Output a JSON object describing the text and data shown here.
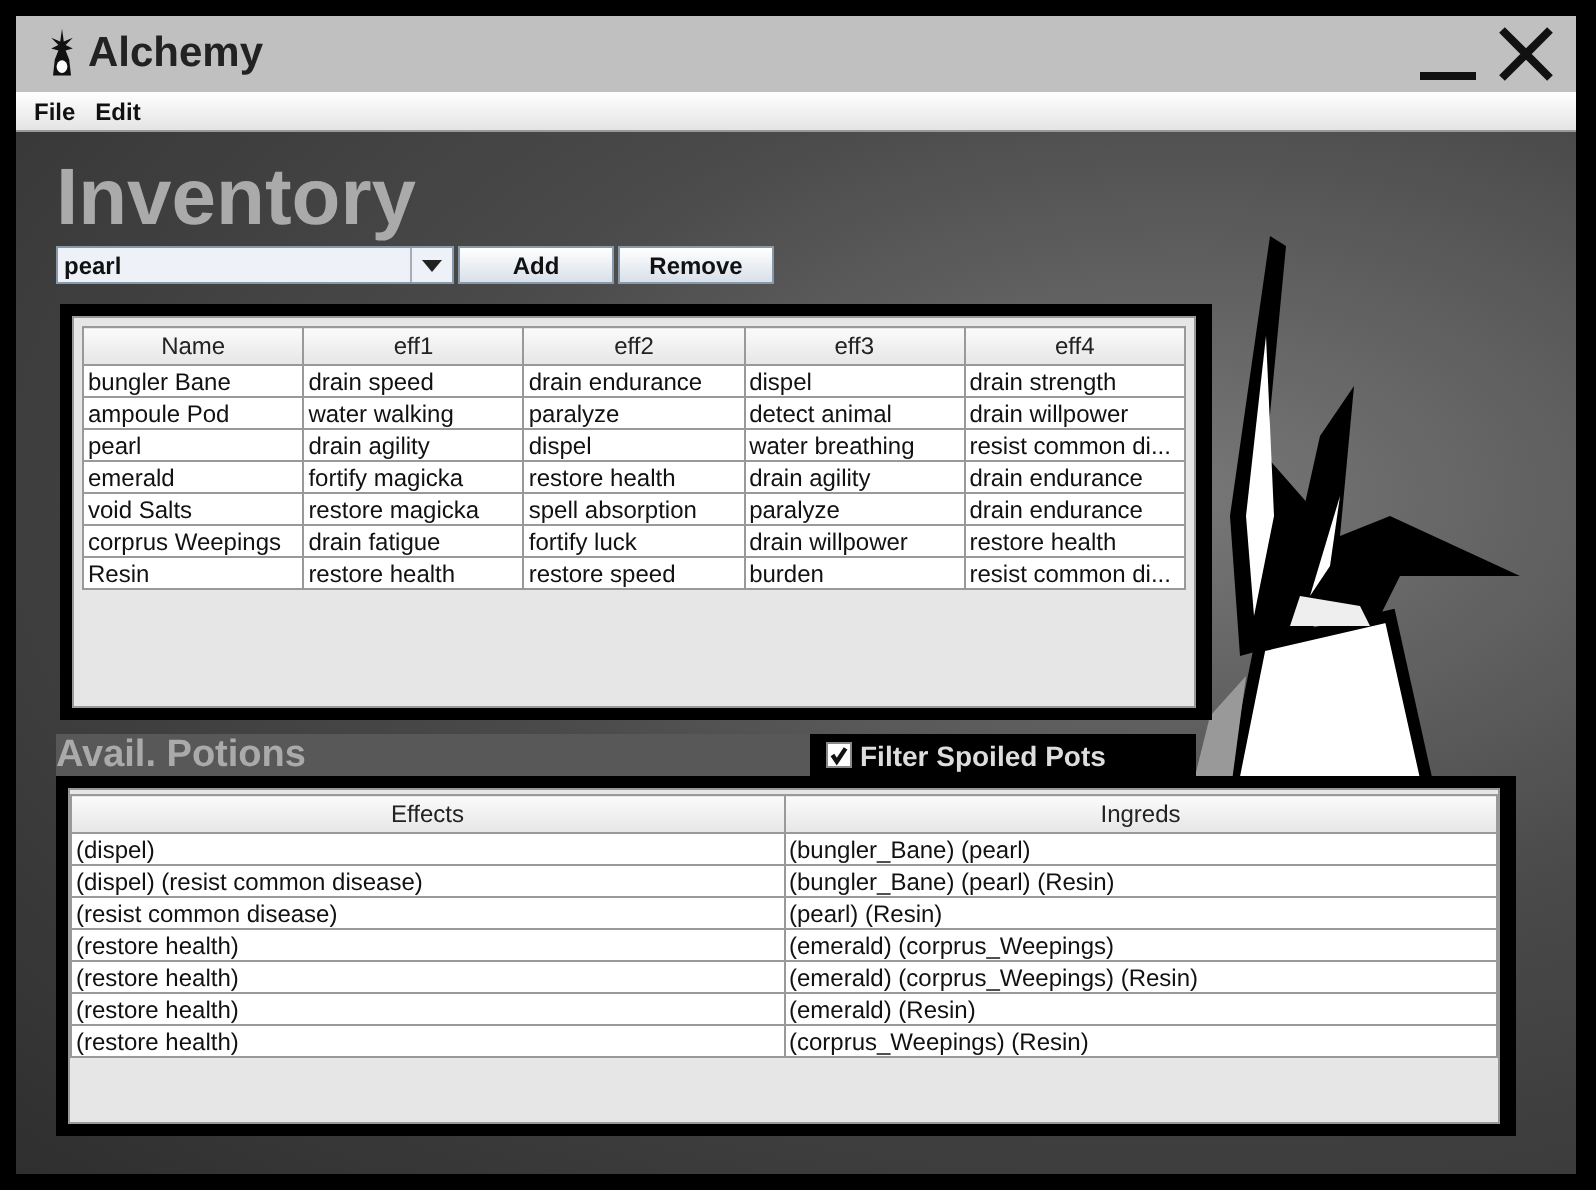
{
  "window": {
    "title": "Alchemy"
  },
  "menu": [
    "File",
    "Edit"
  ],
  "inventory": {
    "heading": "Inventory",
    "combo": {
      "value": "pearl"
    },
    "buttons": [
      "Add",
      "Remove"
    ],
    "table": {
      "columns": [
        "Name",
        "eff1",
        "eff2",
        "eff3",
        "eff4"
      ],
      "rows": [
        [
          "bungler Bane",
          "drain speed",
          "drain endurance",
          "dispel",
          "drain strength"
        ],
        [
          "ampoule Pod",
          "water walking",
          "paralyze",
          "detect animal",
          "drain willpower"
        ],
        [
          "pearl",
          "drain agility",
          "dispel",
          "water breathing",
          "resist common di..."
        ],
        [
          "emerald",
          "fortify magicka",
          "restore health",
          "drain agility",
          "drain endurance"
        ],
        [
          "void Salts",
          "restore magicka",
          "spell absorption",
          "paralyze",
          "drain endurance"
        ],
        [
          "corprus Weepings",
          "drain fatigue",
          "fortify luck",
          "drain willpower",
          "restore health"
        ],
        [
          "Resin",
          "restore health",
          "restore speed",
          "burden",
          "resist common di..."
        ]
      ]
    }
  },
  "potions": {
    "heading": "Avail. Potions",
    "filter": {
      "label": "Filter Spoiled Pots",
      "checked": true
    },
    "table": {
      "columns": [
        "Effects",
        "Ingreds"
      ],
      "rows": [
        [
          "(dispel)",
          "(bungler_Bane)  (pearl)"
        ],
        [
          "(dispel)  (resist common disease)",
          "(bungler_Bane)  (pearl)  (Resin)"
        ],
        [
          "(resist common disease)",
          "(pearl)  (Resin)"
        ],
        [
          "(restore health)",
          "(emerald)  (corprus_Weepings)"
        ],
        [
          "(restore health)",
          "(emerald)  (corprus_Weepings)  (Resin)"
        ],
        [
          "(restore health)",
          "(emerald)  (Resin)"
        ],
        [
          "(restore health)",
          "(corprus_Weepings)  (Resin)"
        ]
      ]
    }
  }
}
